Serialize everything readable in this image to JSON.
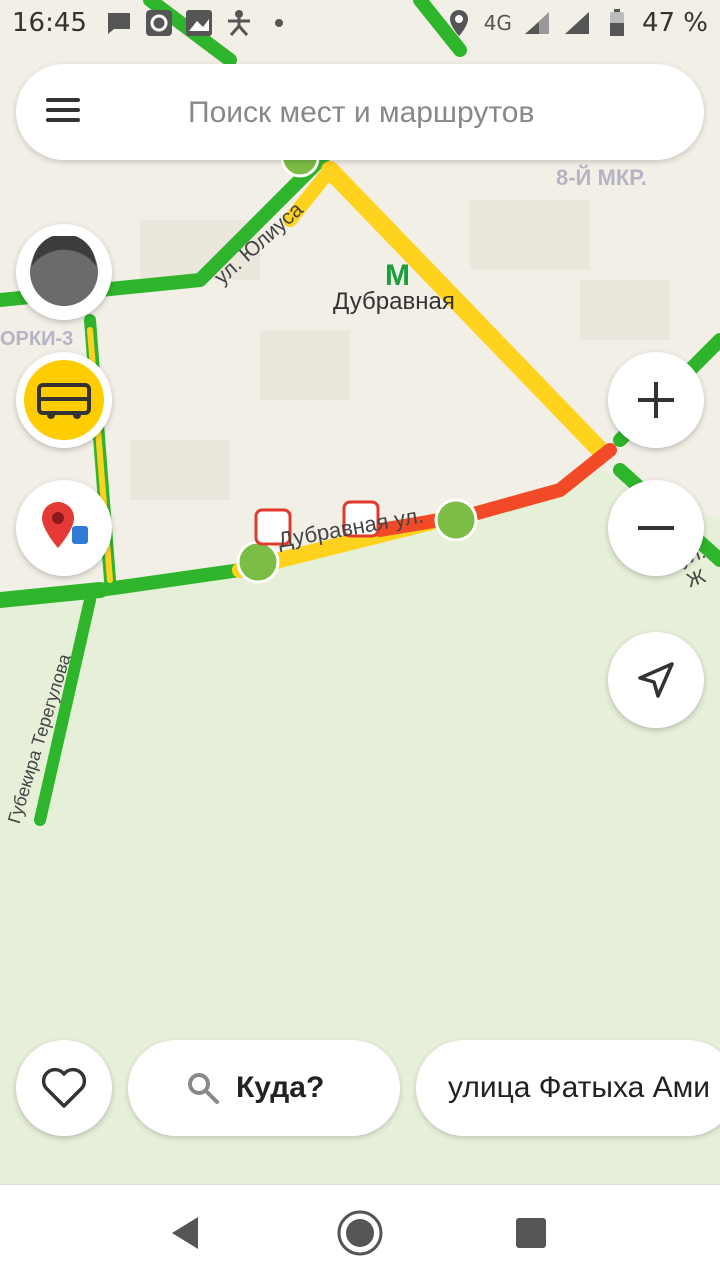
{
  "status_bar": {
    "time": "16:45",
    "network": "4G",
    "battery": "47 %"
  },
  "search": {
    "placeholder": "Поиск мест и маршрутов"
  },
  "map": {
    "labels": {
      "metro": "Дубравная",
      "district": "8-Й МКР.",
      "street_main": "Дубравная ул.",
      "street_julius": "ул. Юлиуса",
      "street_teregulova": "Губекира Терегулова",
      "district_left": "ОРКИ-3",
      "street_right": "ул. Ж"
    },
    "colors": {
      "traffic_green": "#2fb52c",
      "traffic_yellow": "#ffd21e",
      "traffic_red": "#f24a27",
      "park": "#e6f0d9",
      "accent_yellow": "#ffcc00"
    }
  },
  "bottom": {
    "where_label": "Куда?",
    "suggestion": "улица Фатыха Ами"
  }
}
